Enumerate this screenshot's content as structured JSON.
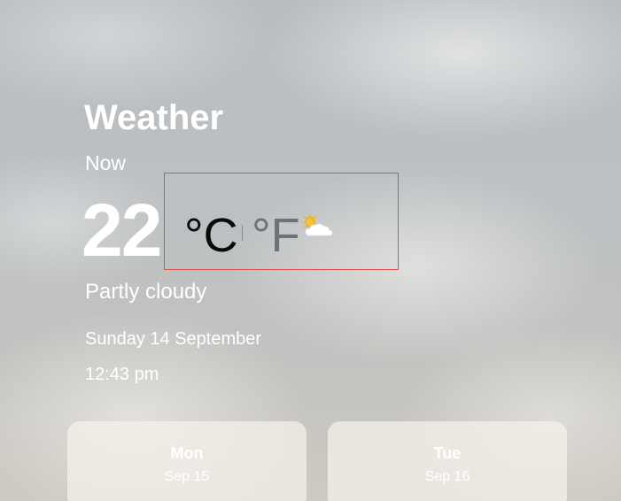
{
  "app": {
    "title": "Weather"
  },
  "current": {
    "label": "Now",
    "temperature": "22",
    "unit_celsius": "°C",
    "unit_fahrenheit": "°F",
    "active_unit": "°C",
    "condition": "Partly cloudy",
    "icon": "partly-cloudy-icon",
    "date": "Sunday 14 September",
    "time": "12:43 pm"
  },
  "forecast": [
    {
      "day": "Mon",
      "date": "Sep 15"
    },
    {
      "day": "Tue",
      "date": "Sep 16"
    }
  ],
  "colors": {
    "selection_box": "#d9534f",
    "active_unit": "#0a0a0a",
    "inactive_unit": "#6c727a",
    "sun": "#f5b82e"
  }
}
